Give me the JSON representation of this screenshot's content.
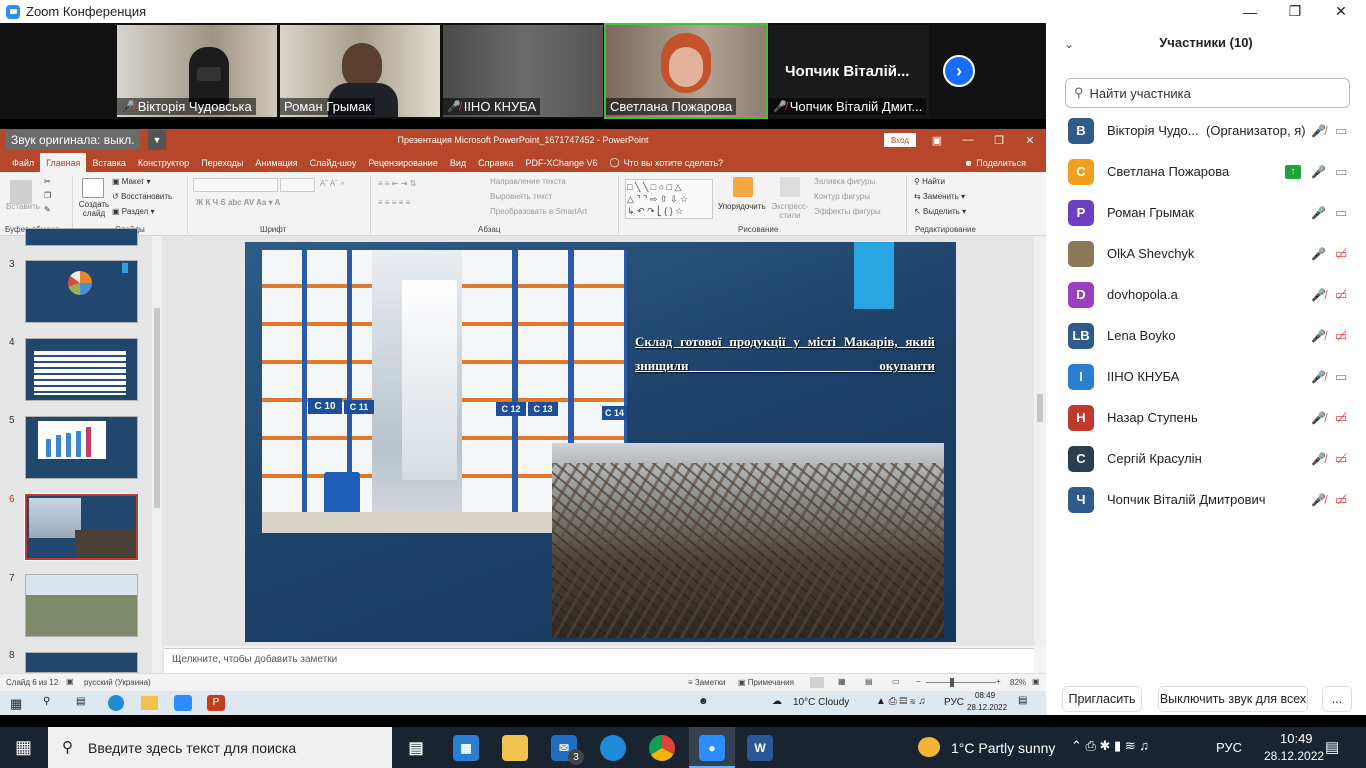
{
  "zoom": {
    "title": "Zoom Конференция",
    "videos": [
      {
        "name": "Вікторія Чудовська",
        "muted": true
      },
      {
        "name": "Роман Грымак",
        "muted": false
      },
      {
        "name": "ІІНО КНУБА",
        "muted": true
      },
      {
        "name": "Светлана Пожарова",
        "muted": false
      },
      {
        "name": "Чопчик Віталій Дмит...",
        "muted": true,
        "big_label": "Чопчик  Віталій..."
      }
    ]
  },
  "ppt": {
    "original_sound": "Звук оригинала: выкл.",
    "window_title": "Презентация Microsoft PowerPoint_1671747452  -  PowerPoint",
    "login": "Вход",
    "tabs": [
      "Файл",
      "Главная",
      "Вставка",
      "Конструктор",
      "Переходы",
      "Анимация",
      "Слайд-шоу",
      "Рецензирование",
      "Вид",
      "Справка",
      "PDF-XChange V6",
      "Что вы хотите сделать?"
    ],
    "share": "Поделиться",
    "ribbon": {
      "paste": "Вставить",
      "clipboard": "Буфер обмена",
      "create_slide": "Создать слайд",
      "layout": "Макет",
      "restore": "Восстановить",
      "section": "Раздел",
      "slides": "Слайды",
      "font": "Шрифт",
      "paragraph": "Абзац",
      "text_direction": "Направление текста",
      "align_text": "Выровнять текст",
      "smartart": "Преобразовать в SmartArt",
      "arrange": "Упорядочить",
      "express_styles": "Экспресс-стили",
      "fill": "Заливка фигуры",
      "outline": "Контур фигуры",
      "effects": "Эффекты фигуры",
      "drawing": "Рисование",
      "find": "Найти",
      "replace": "Заменить",
      "select": "Выделить",
      "editing": "Редактирование"
    },
    "thumbnails": [
      "3",
      "4",
      "5",
      "6",
      "7",
      "8"
    ],
    "selected_slide": "6",
    "slide_title": "Склад готової продукції у місті Макарів, який знищили окупанти",
    "notes_placeholder": "Щелкните, чтобы добавить заметки",
    "status": {
      "slide_of": "Слайд 6 из 12",
      "language": "русский (Украина)",
      "notes": "Заметки",
      "comments": "Примечания",
      "zoom": "82%"
    },
    "inner_taskbar": {
      "weather": "10°C  Cloudy",
      "lang": "РУС",
      "time": "08:49",
      "date": "28.12.2022"
    }
  },
  "panel": {
    "title": "Участники (10)",
    "search_placeholder": "Найти участника",
    "participants": [
      {
        "initial": "В",
        "name": "Вікторія Чудо...",
        "role": "(Организатор, я)",
        "color": "#2f5a8a",
        "mic": "off",
        "video": "on"
      },
      {
        "initial": "С",
        "name": "Светлана Пожарова",
        "role": "",
        "color": "#f0a020",
        "mic": "on",
        "video": "on",
        "share": true
      },
      {
        "initial": "Р",
        "name": "Роман Грымак",
        "role": "",
        "color": "#6a3fc2",
        "mic": "on",
        "video": "on"
      },
      {
        "initial": "",
        "name": "OlkA Shevchyk",
        "role": "",
        "color": "#8a7a5a",
        "mic": "on",
        "video": "off"
      },
      {
        "initial": "D",
        "name": "dovhopola.a",
        "role": "",
        "color": "#9b3fc2",
        "mic": "off",
        "video": "off"
      },
      {
        "initial": "LB",
        "name": "Lena Boyko",
        "role": "",
        "color": "#2f5a8a",
        "mic": "off",
        "video": "off"
      },
      {
        "initial": "І",
        "name": "ІІНО КНУБА",
        "role": "",
        "color": "#2a7fd0",
        "mic": "off",
        "video": "on"
      },
      {
        "initial": "Н",
        "name": "Назар Ступень",
        "role": "",
        "color": "#c0392b",
        "mic": "off",
        "video": "off"
      },
      {
        "initial": "С",
        "name": "Сергій Красулін",
        "role": "",
        "color": "#2c3e50",
        "mic": "off",
        "video": "off"
      },
      {
        "initial": "Ч",
        "name": "Чопчик Віталій Дмитрович",
        "role": "",
        "color": "#2f5a8a",
        "mic": "off",
        "video": "off"
      }
    ],
    "invite": "Пригласить",
    "mute_all": "Выключить звук для всех",
    "more": "..."
  },
  "taskbar": {
    "search_placeholder": "Введите здесь текст для поиска",
    "mail_badge": "3",
    "weather": "1°C  Partly sunny",
    "lang": "РУС",
    "time": "10:49",
    "date": "28.12.2022"
  }
}
